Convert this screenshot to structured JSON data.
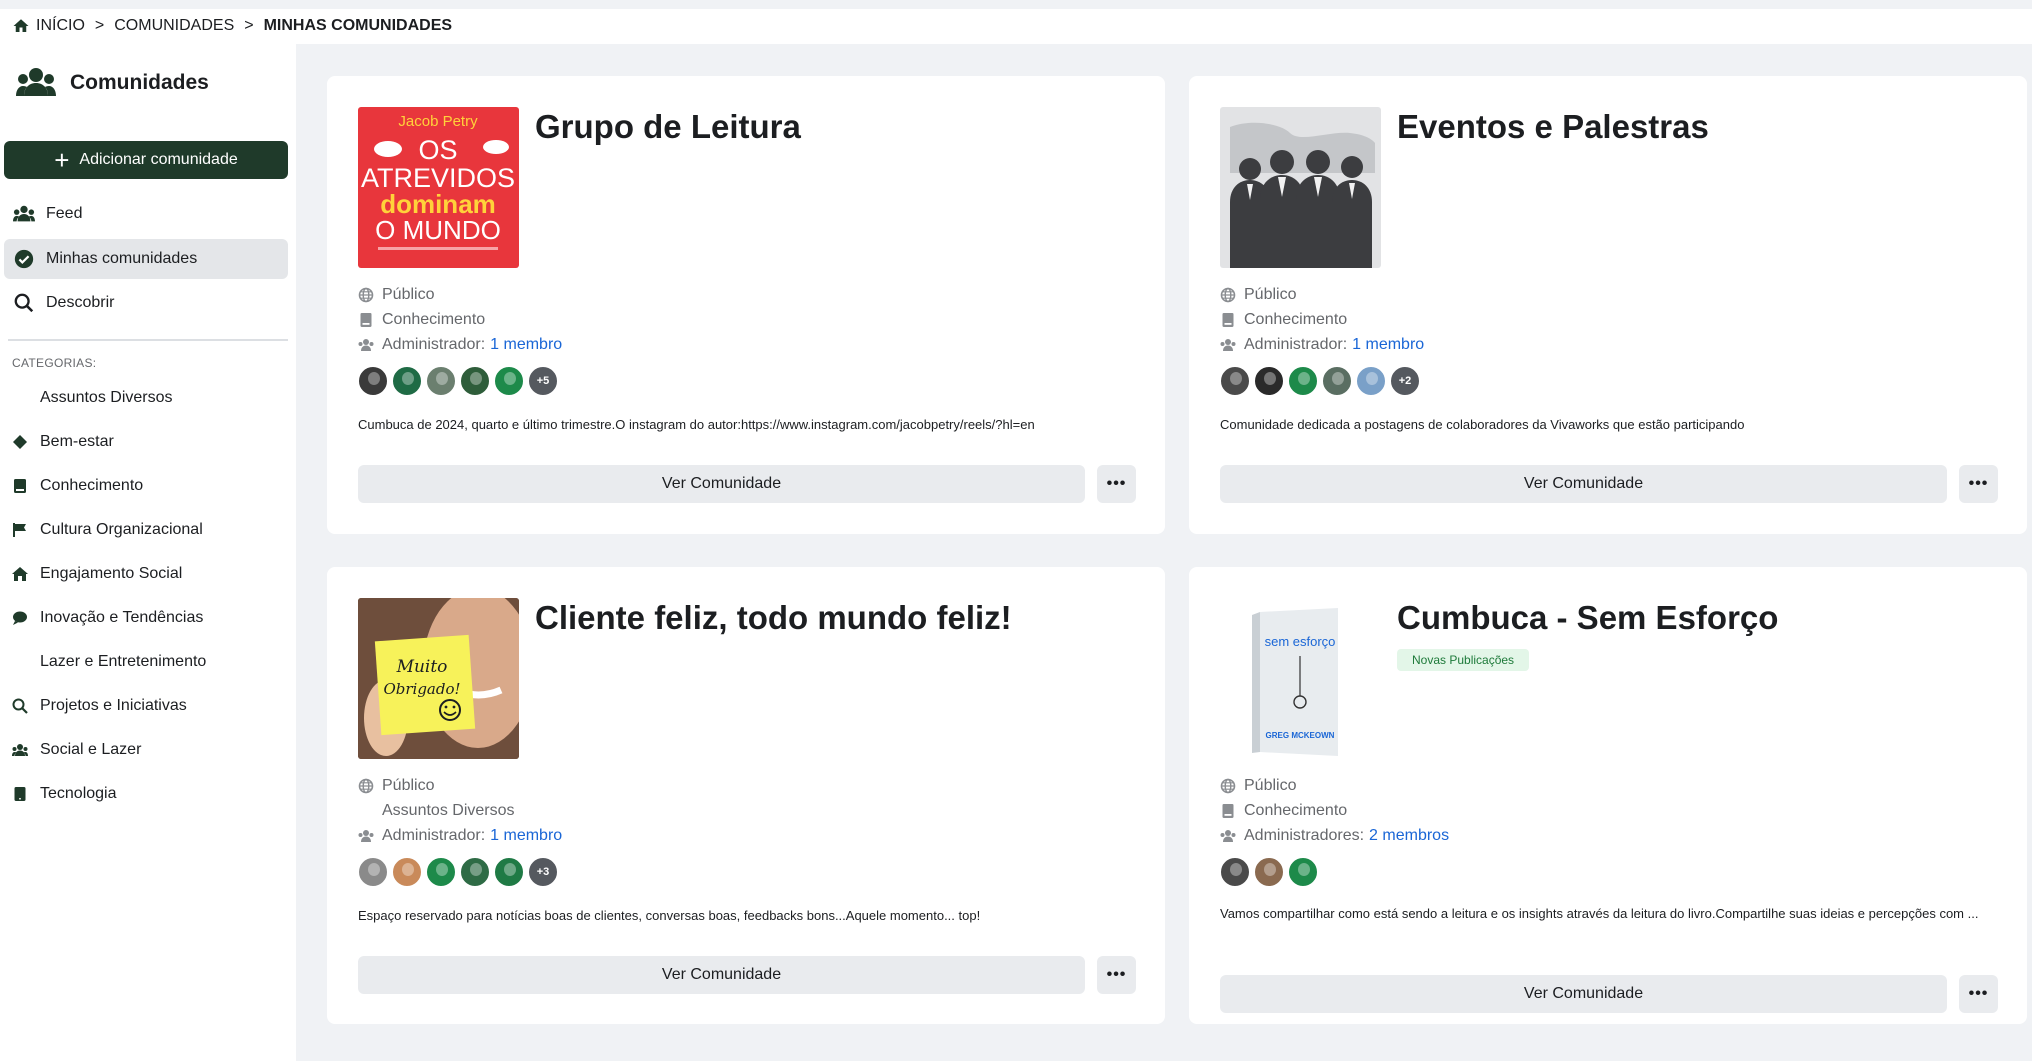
{
  "breadcrumb": {
    "home": "INÍCIO",
    "separator": ">",
    "level2": "COMUNIDADES",
    "current": "MINHAS COMUNIDADES"
  },
  "sidebar": {
    "title": "Comunidades",
    "add_button": "Adicionar comunidade",
    "nav": [
      {
        "label": "Feed",
        "icon": "users-icon"
      },
      {
        "label": "Minhas comunidades",
        "icon": "check-circle-icon",
        "active": true
      },
      {
        "label": "Descobrir",
        "icon": "search-icon"
      }
    ],
    "categories_title": "CATEGORIAS:",
    "categories": [
      {
        "label": "Assuntos Diversos",
        "icon": ""
      },
      {
        "label": "Bem-estar",
        "icon": "diamond-icon"
      },
      {
        "label": "Conhecimento",
        "icon": "book-icon"
      },
      {
        "label": "Cultura Organizacional",
        "icon": "flag-icon"
      },
      {
        "label": "Engajamento Social",
        "icon": "home-icon"
      },
      {
        "label": "Inovação e Tendências",
        "icon": "comment-icon"
      },
      {
        "label": "Lazer e Entretenimento",
        "icon": ""
      },
      {
        "label": "Projetos e Iniciativas",
        "icon": "search-icon"
      },
      {
        "label": "Social e Lazer",
        "icon": "users-icon"
      },
      {
        "label": "Tecnologia",
        "icon": "tablet-icon"
      }
    ]
  },
  "cards": [
    {
      "title": "Grupo de Leitura",
      "thumb_author": "Jacob Petry",
      "thumb_line1": "OS",
      "thumb_line2": "ATREVIDOS",
      "thumb_line3": "dominam",
      "thumb_line4": "O MUNDO",
      "privacy": "Público",
      "category": "Conhecimento",
      "admin_label": "Administrador:",
      "admin_link": "1 membro",
      "avatar_colors": [
        "#3a3a3a",
        "#1f6b45",
        "#6b7f6f",
        "#2e5d3a",
        "#1d8a4a"
      ],
      "more_count": "+5",
      "description": "Cumbuca de 2024, quarto e último trimestre.O instagram do autor:https://www.instagram.com/jacobpetry/reels/?hl=en",
      "view_button": "Ver Comunidade",
      "more_button": "•••"
    },
    {
      "title": "Eventos e Palestras",
      "privacy": "Público",
      "category": "Conhecimento",
      "admin_label": "Administrador:",
      "admin_link": "1 membro",
      "avatar_colors": [
        "#4a4a4a",
        "#2a2a2a",
        "#1d8a4a",
        "#5a6e62",
        "#7aa0c8"
      ],
      "more_count": "+2",
      "description": "Comunidade dedicada a postagens de colaboradores da Vivaworks que estão participando",
      "view_button": "Ver Comunidade",
      "more_button": "•••"
    },
    {
      "title": "Cliente feliz, todo mundo feliz!",
      "thumb_note": "Muito Obrigado!",
      "privacy": "Público",
      "category": "Assuntos Diversos",
      "admin_label": "Administrador:",
      "admin_link": "1 membro",
      "avatar_colors": [
        "#8a8a8a",
        "#c98a5a",
        "#1d8a4a",
        "#2e6b45",
        "#1f7a45"
      ],
      "more_count": "+3",
      "description": "Espaço reservado para notícias boas de clientes, conversas boas, feedbacks bons...Aquele momento... top!",
      "view_button": "Ver Comunidade",
      "more_button": "•••"
    },
    {
      "title": "Cumbuca - Sem Esforço",
      "badge": "Novas Publicações",
      "thumb_title": "sem esforço",
      "thumb_author": "GREG MCKEOWN",
      "privacy": "Público",
      "category": "Conhecimento",
      "admin_label": "Administradores:",
      "admin_link": "2 membros",
      "avatar_colors": [
        "#4a4a4a",
        "#8a6a50",
        "#1d8a4a"
      ],
      "more_count": "",
      "description": "Vamos compartilhar como está sendo a leitura e os insights através da leitura do livro.Compartilhe suas ideias e percepções com ...",
      "view_button": "Ver Comunidade",
      "more_button": "•••"
    }
  ]
}
